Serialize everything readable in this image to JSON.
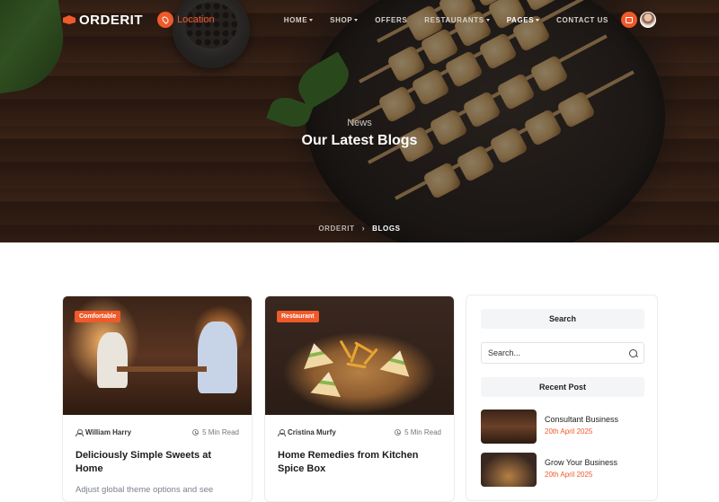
{
  "brand": {
    "name": "ORDERIT",
    "accent": "#f0592a"
  },
  "location_label": "Location",
  "nav": {
    "items": [
      {
        "label": "HOME",
        "dropdown": true,
        "active": false
      },
      {
        "label": "SHOP",
        "dropdown": true,
        "active": false
      },
      {
        "label": "OFFERS",
        "dropdown": false,
        "active": false
      },
      {
        "label": "RESTAURANTS",
        "dropdown": true,
        "active": false
      },
      {
        "label": "PAGES",
        "dropdown": true,
        "active": true
      },
      {
        "label": "CONTACT US",
        "dropdown": false,
        "active": false
      }
    ]
  },
  "hero": {
    "subtitle": "News",
    "title": "Our Latest Blogs",
    "breadcrumb": {
      "home": "ORDERIT",
      "separator": "›",
      "current": "BLOGS"
    }
  },
  "posts": [
    {
      "tag": "Comfortable",
      "author": "William Harry",
      "read_time": "5 Min Read",
      "title": "Deliciously Simple Sweets at Home",
      "excerpt": "Adjust global theme options and see"
    },
    {
      "tag": "Restaurant",
      "author": "Cristina Murfy",
      "read_time": "5 Min Read",
      "title": "Home Remedies from Kitchen Spice Box",
      "excerpt": ""
    }
  ],
  "sidebar": {
    "search_heading": "Search",
    "search_placeholder": "Search...",
    "recent_heading": "Recent Post",
    "recent_posts": [
      {
        "title": "Consultant Business",
        "date": "20th April 2025"
      },
      {
        "title": "Grow Your Business",
        "date": "20th April 2025"
      }
    ]
  }
}
